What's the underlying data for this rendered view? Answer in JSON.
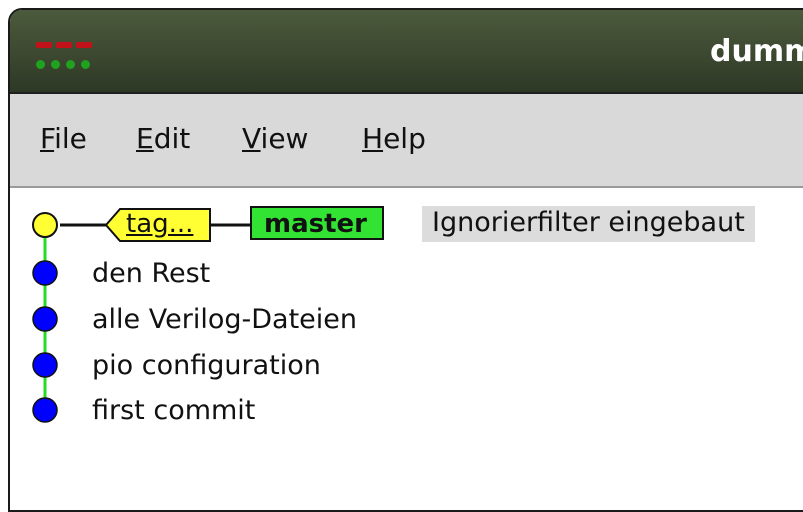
{
  "window": {
    "title": "dumm",
    "colors": {
      "titlebar": "#3c4830",
      "red_lights": "#c1121a",
      "green_lights": "#1fa31f"
    }
  },
  "menu": {
    "items": [
      {
        "mnemonic": "F",
        "rest": "ile"
      },
      {
        "mnemonic": "E",
        "rest": "dit"
      },
      {
        "mnemonic": "V",
        "rest": "iew"
      },
      {
        "mnemonic": "H",
        "rest": "elp"
      }
    ]
  },
  "history": {
    "tag_label": "tag...",
    "branch_label": "master",
    "colors": {
      "tag": "#ffff33",
      "branch": "#33e333",
      "head_dot": "#ffff33",
      "commit_dot": "#0000ff",
      "line": "#22dd22"
    },
    "commits": [
      {
        "message": "Ignorierfilter eingebaut",
        "head": true
      },
      {
        "message": "den Rest",
        "head": false
      },
      {
        "message": "alle Verilog-Dateien",
        "head": false
      },
      {
        "message": "pio configuration",
        "head": false
      },
      {
        "message": "first commit",
        "head": false
      }
    ]
  }
}
